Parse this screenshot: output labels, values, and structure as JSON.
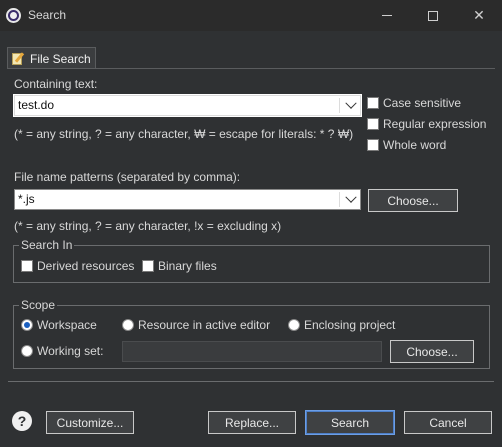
{
  "window": {
    "title": "Search"
  },
  "tab": {
    "label": "File Search"
  },
  "containing": {
    "label": "Containing text:",
    "value": "test.do",
    "hint": "(* = any string, ? = any character, ₩ = escape for literals: * ? ₩)"
  },
  "options": {
    "case_sensitive": "Case sensitive",
    "regex": "Regular expression",
    "whole_word": "Whole word"
  },
  "patterns": {
    "label": "File name patterns (separated by comma):",
    "value": "*.js",
    "hint": "(* = any string, ? = any character, !x = excluding x)",
    "choose_label": "Choose..."
  },
  "search_in": {
    "title": "Search In",
    "derived": "Derived resources",
    "binary": "Binary files"
  },
  "scope": {
    "title": "Scope",
    "workspace": "Workspace",
    "active_editor": "Resource in active editor",
    "enclosing": "Enclosing project",
    "working_set": "Working set:",
    "choose_label": "Choose...",
    "selected": "Workspace"
  },
  "footer": {
    "customize": "Customize...",
    "replace": "Replace...",
    "search": "Search",
    "cancel": "Cancel"
  },
  "icons": {
    "app": "eclipse-icon",
    "tab": "file-search-icon",
    "help": "help-icon"
  }
}
